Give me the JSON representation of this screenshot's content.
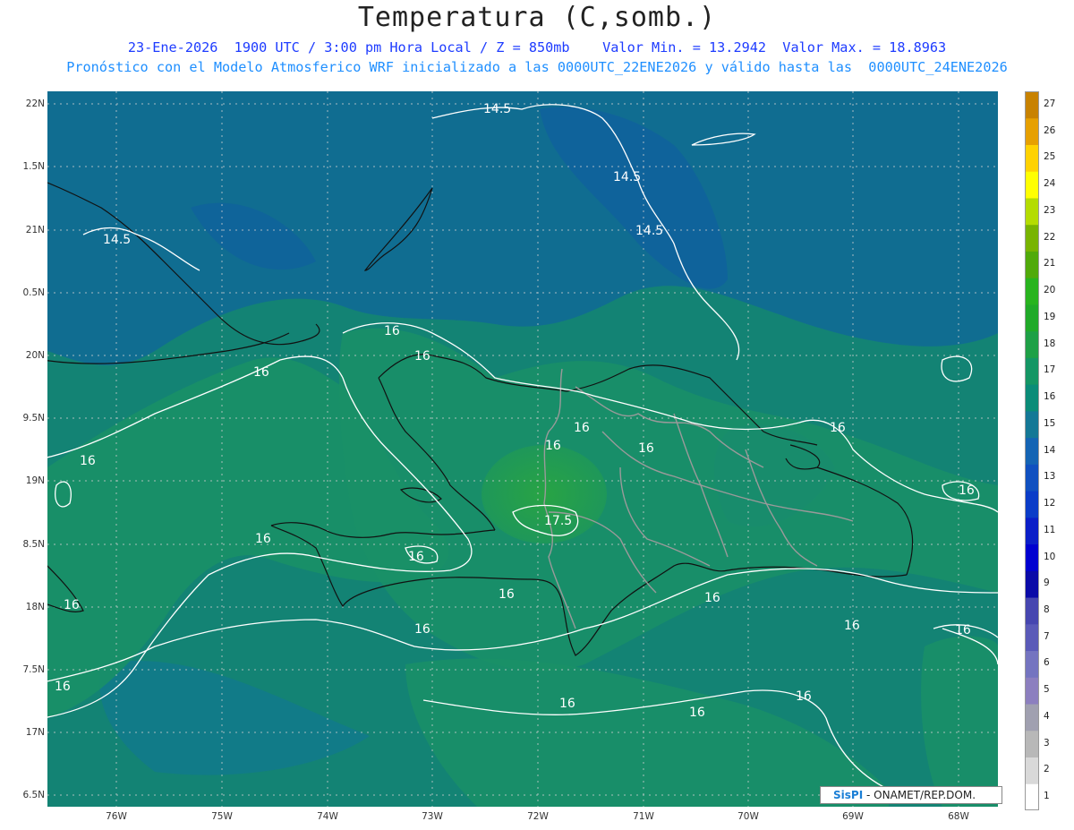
{
  "header": {
    "title": "Temperatura (C,somb.)",
    "line1": "23-Ene-2026  1900 UTC / 3:00 pm Hora Local / Z = 850mb    Valor Min. = 13.2942  Valor Max. = 18.8963",
    "line2": "Pronóstico con el Modelo Atmosferico WRF inicializado a las 0000UTC_22ENE2026 y válido hasta las  0000UTC_24ENE2026"
  },
  "axes": {
    "lat_labels": [
      "22N",
      "1.5N",
      "21N",
      "0.5N",
      "20N",
      "9.5N",
      "19N",
      "8.5N",
      "18N",
      "7.5N",
      "17N",
      "6.5N"
    ],
    "lon_labels": [
      "76W",
      "75W",
      "74W",
      "73W",
      "72W",
      "71W",
      "70W",
      "69W",
      "68W"
    ]
  },
  "colorbar": {
    "labels": [
      "1",
      "2",
      "3",
      "4",
      "5",
      "6",
      "7",
      "8",
      "9",
      "10",
      "11",
      "12",
      "13",
      "14",
      "15",
      "16",
      "17",
      "18",
      "19",
      "20",
      "21",
      "22",
      "23",
      "24",
      "25",
      "26",
      "27"
    ],
    "colors": [
      "#ffffff",
      "#d9d9d9",
      "#b8b8b8",
      "#a0a0b0",
      "#8c7fbf",
      "#7474c0",
      "#5a5ab8",
      "#4646b0",
      "#0a0aa8",
      "#0000d0",
      "#0a1ec8",
      "#0a3cc8",
      "#1050c0",
      "#1464b4",
      "#147896",
      "#0a8c78",
      "#149664",
      "#1ea046",
      "#20aa28",
      "#28b41e",
      "#50aa0a",
      "#78b400",
      "#b4dc00",
      "#ffff00",
      "#ffd200",
      "#e6a000",
      "#c88200"
    ]
  },
  "contour_labels": [
    "14.5",
    "14.5",
    "14.5",
    "14.5",
    "16",
    "16",
    "16",
    "16",
    "16",
    "16",
    "16",
    "16",
    "16",
    "16",
    "16",
    "16",
    "16",
    "16",
    "16",
    "16",
    "16",
    "16",
    "16",
    "16",
    "16",
    "17.5"
  ],
  "credit": {
    "logo": "SisPI",
    "text": "- ONAMET/REP.DOM."
  }
}
